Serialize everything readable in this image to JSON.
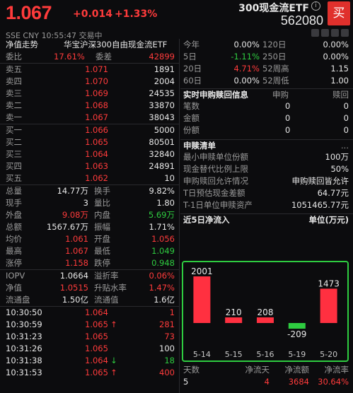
{
  "header": {
    "price": "1.067",
    "change": "+0.014",
    "change_pct": "+1.33%",
    "fund_name": "300现金流ETF",
    "code": "562080",
    "buy_label": "买",
    "market": "SSE",
    "currency": "CNY",
    "time": "10:55:47",
    "status": "交易中"
  },
  "left": {
    "title_label": "净值走势",
    "title_value": "华宝沪深300自由现金流ETF",
    "webi": {
      "label": "委比",
      "value": "17.61%",
      "label2": "委差",
      "value2": "42899"
    },
    "asks": [
      {
        "label": "卖五",
        "price": "1.071",
        "vol": "1891"
      },
      {
        "label": "卖四",
        "price": "1.070",
        "vol": "2004"
      },
      {
        "label": "卖三",
        "price": "1.069",
        "vol": "24535"
      },
      {
        "label": "卖二",
        "price": "1.068",
        "vol": "33870"
      },
      {
        "label": "卖一",
        "price": "1.067",
        "vol": "38043"
      }
    ],
    "bids": [
      {
        "label": "买一",
        "price": "1.066",
        "vol": "5000"
      },
      {
        "label": "买二",
        "price": "1.065",
        "vol": "80501"
      },
      {
        "label": "买三",
        "price": "1.064",
        "vol": "32840"
      },
      {
        "label": "买四",
        "price": "1.063",
        "vol": "24891"
      },
      {
        "label": "买五",
        "price": "1.062",
        "vol": "10"
      }
    ],
    "stats": [
      {
        "l1": "总量",
        "v1": "14.77万",
        "c1": "white",
        "l2": "换手",
        "v2": "9.82%",
        "c2": "white"
      },
      {
        "l1": "现手",
        "v1": "3",
        "c1": "white",
        "l2": "量比",
        "v2": "1.80",
        "c2": "white"
      },
      {
        "l1": "外盘",
        "v1": "9.08万",
        "c1": "red",
        "l2": "内盘",
        "v2": "5.69万",
        "c2": "green"
      },
      {
        "l1": "总额",
        "v1": "1567.67万",
        "c1": "white",
        "l2": "振幅",
        "v2": "1.71%",
        "c2": "white"
      },
      {
        "l1": "均价",
        "v1": "1.061",
        "c1": "red",
        "l2": "开盘",
        "v2": "1.056",
        "c2": "red"
      },
      {
        "l1": "最高",
        "v1": "1.067",
        "c1": "red",
        "l2": "最低",
        "v2": "1.049",
        "c2": "green"
      },
      {
        "l1": "涨停",
        "v1": "1.158",
        "c1": "red",
        "l2": "跌停",
        "v2": "0.948",
        "c2": "green"
      }
    ],
    "iopv": [
      {
        "l1": "IOPV",
        "v1": "1.0664",
        "c1": "white",
        "l2": "溢折率",
        "v2": "0.06%",
        "c2": "red"
      },
      {
        "l1": "净值",
        "v1": "1.0515",
        "c1": "red",
        "l2": "升贴水率",
        "v2": "1.47%",
        "c2": "red"
      },
      {
        "l1": "流通盘",
        "v1": "1.50亿",
        "c1": "white",
        "l2": "流通值",
        "v2": "1.6亿",
        "c2": "white"
      }
    ],
    "ticks": [
      {
        "time": "10:30:50",
        "price": "1.064",
        "arrow": "",
        "vol": "1",
        "c": "red"
      },
      {
        "time": "10:30:59",
        "price": "1.065",
        "arrow": "↑",
        "vol": "281",
        "c": "red"
      },
      {
        "time": "10:31:23",
        "price": "1.065",
        "arrow": "",
        "vol": "73",
        "c": "red"
      },
      {
        "time": "10:31:26",
        "price": "1.065",
        "arrow": "",
        "vol": "100",
        "c": "white"
      },
      {
        "time": "10:31:38",
        "price": "1.064",
        "arrow": "↓",
        "vol": "18",
        "c": "green"
      },
      {
        "time": "10:31:53",
        "price": "1.065",
        "arrow": "↑",
        "vol": "400",
        "c": "red"
      }
    ]
  },
  "right": {
    "perf": [
      {
        "l1": "今年",
        "v1": "0.00%",
        "c1": "white",
        "l2": "120日",
        "v2": "0.00%",
        "c2": "white"
      },
      {
        "l1": "5日",
        "v1": "-1.11%",
        "c1": "green",
        "l2": "250日",
        "v2": "0.00%",
        "c2": "white"
      },
      {
        "l1": "20日",
        "v1": "4.71%",
        "c1": "red",
        "l2": "52周高",
        "v2": "1.15",
        "c2": "white"
      },
      {
        "l1": "60日",
        "v1": "0.00%",
        "c1": "white",
        "l2": "52周低",
        "v2": "1.00",
        "c2": "white"
      }
    ],
    "rt_title": "实时申购赎回信息",
    "rt_col1": "申购",
    "rt_col2": "赎回",
    "rt_rows": [
      {
        "label": "笔数",
        "v1": "0",
        "v2": "0"
      },
      {
        "label": "金额",
        "v1": "0",
        "v2": "0"
      },
      {
        "label": "份额",
        "v1": "0",
        "v2": "0"
      }
    ],
    "list_title": "申赎清单",
    "list_more": "...",
    "list_rows": [
      {
        "label": "最小申赎单位份额",
        "value": "100万"
      },
      {
        "label": "现金替代比例上限",
        "value": "50%"
      },
      {
        "label": "申购赎回允许情况",
        "value": "申购赎回皆允许"
      },
      {
        "label": "T日预估现金差额",
        "value": "64.77元"
      },
      {
        "label": "T-1日单位申赎资产",
        "value": "1051465.77元"
      }
    ],
    "flow_title": "近5日净流入",
    "flow_unit": "单位(万元)",
    "summary_headers": [
      "天数",
      "净流天",
      "净流额",
      "净流率"
    ],
    "summary_values": [
      "5",
      "4",
      "3684",
      "30.64%"
    ]
  },
  "chart_data": {
    "type": "bar",
    "title": "近5日净流入",
    "unit": "单位(万元)",
    "categories": [
      "5-14",
      "5-15",
      "5-16",
      "5-19",
      "5-20"
    ],
    "values": [
      2001,
      210,
      208,
      -209,
      1473
    ],
    "colors": {
      "positive": "#ff3040",
      "negative": "#2ecc40"
    }
  },
  "colors": {
    "up": "#ff3b3b",
    "down": "#2ecc40",
    "accent_border": "#2ecc40"
  }
}
